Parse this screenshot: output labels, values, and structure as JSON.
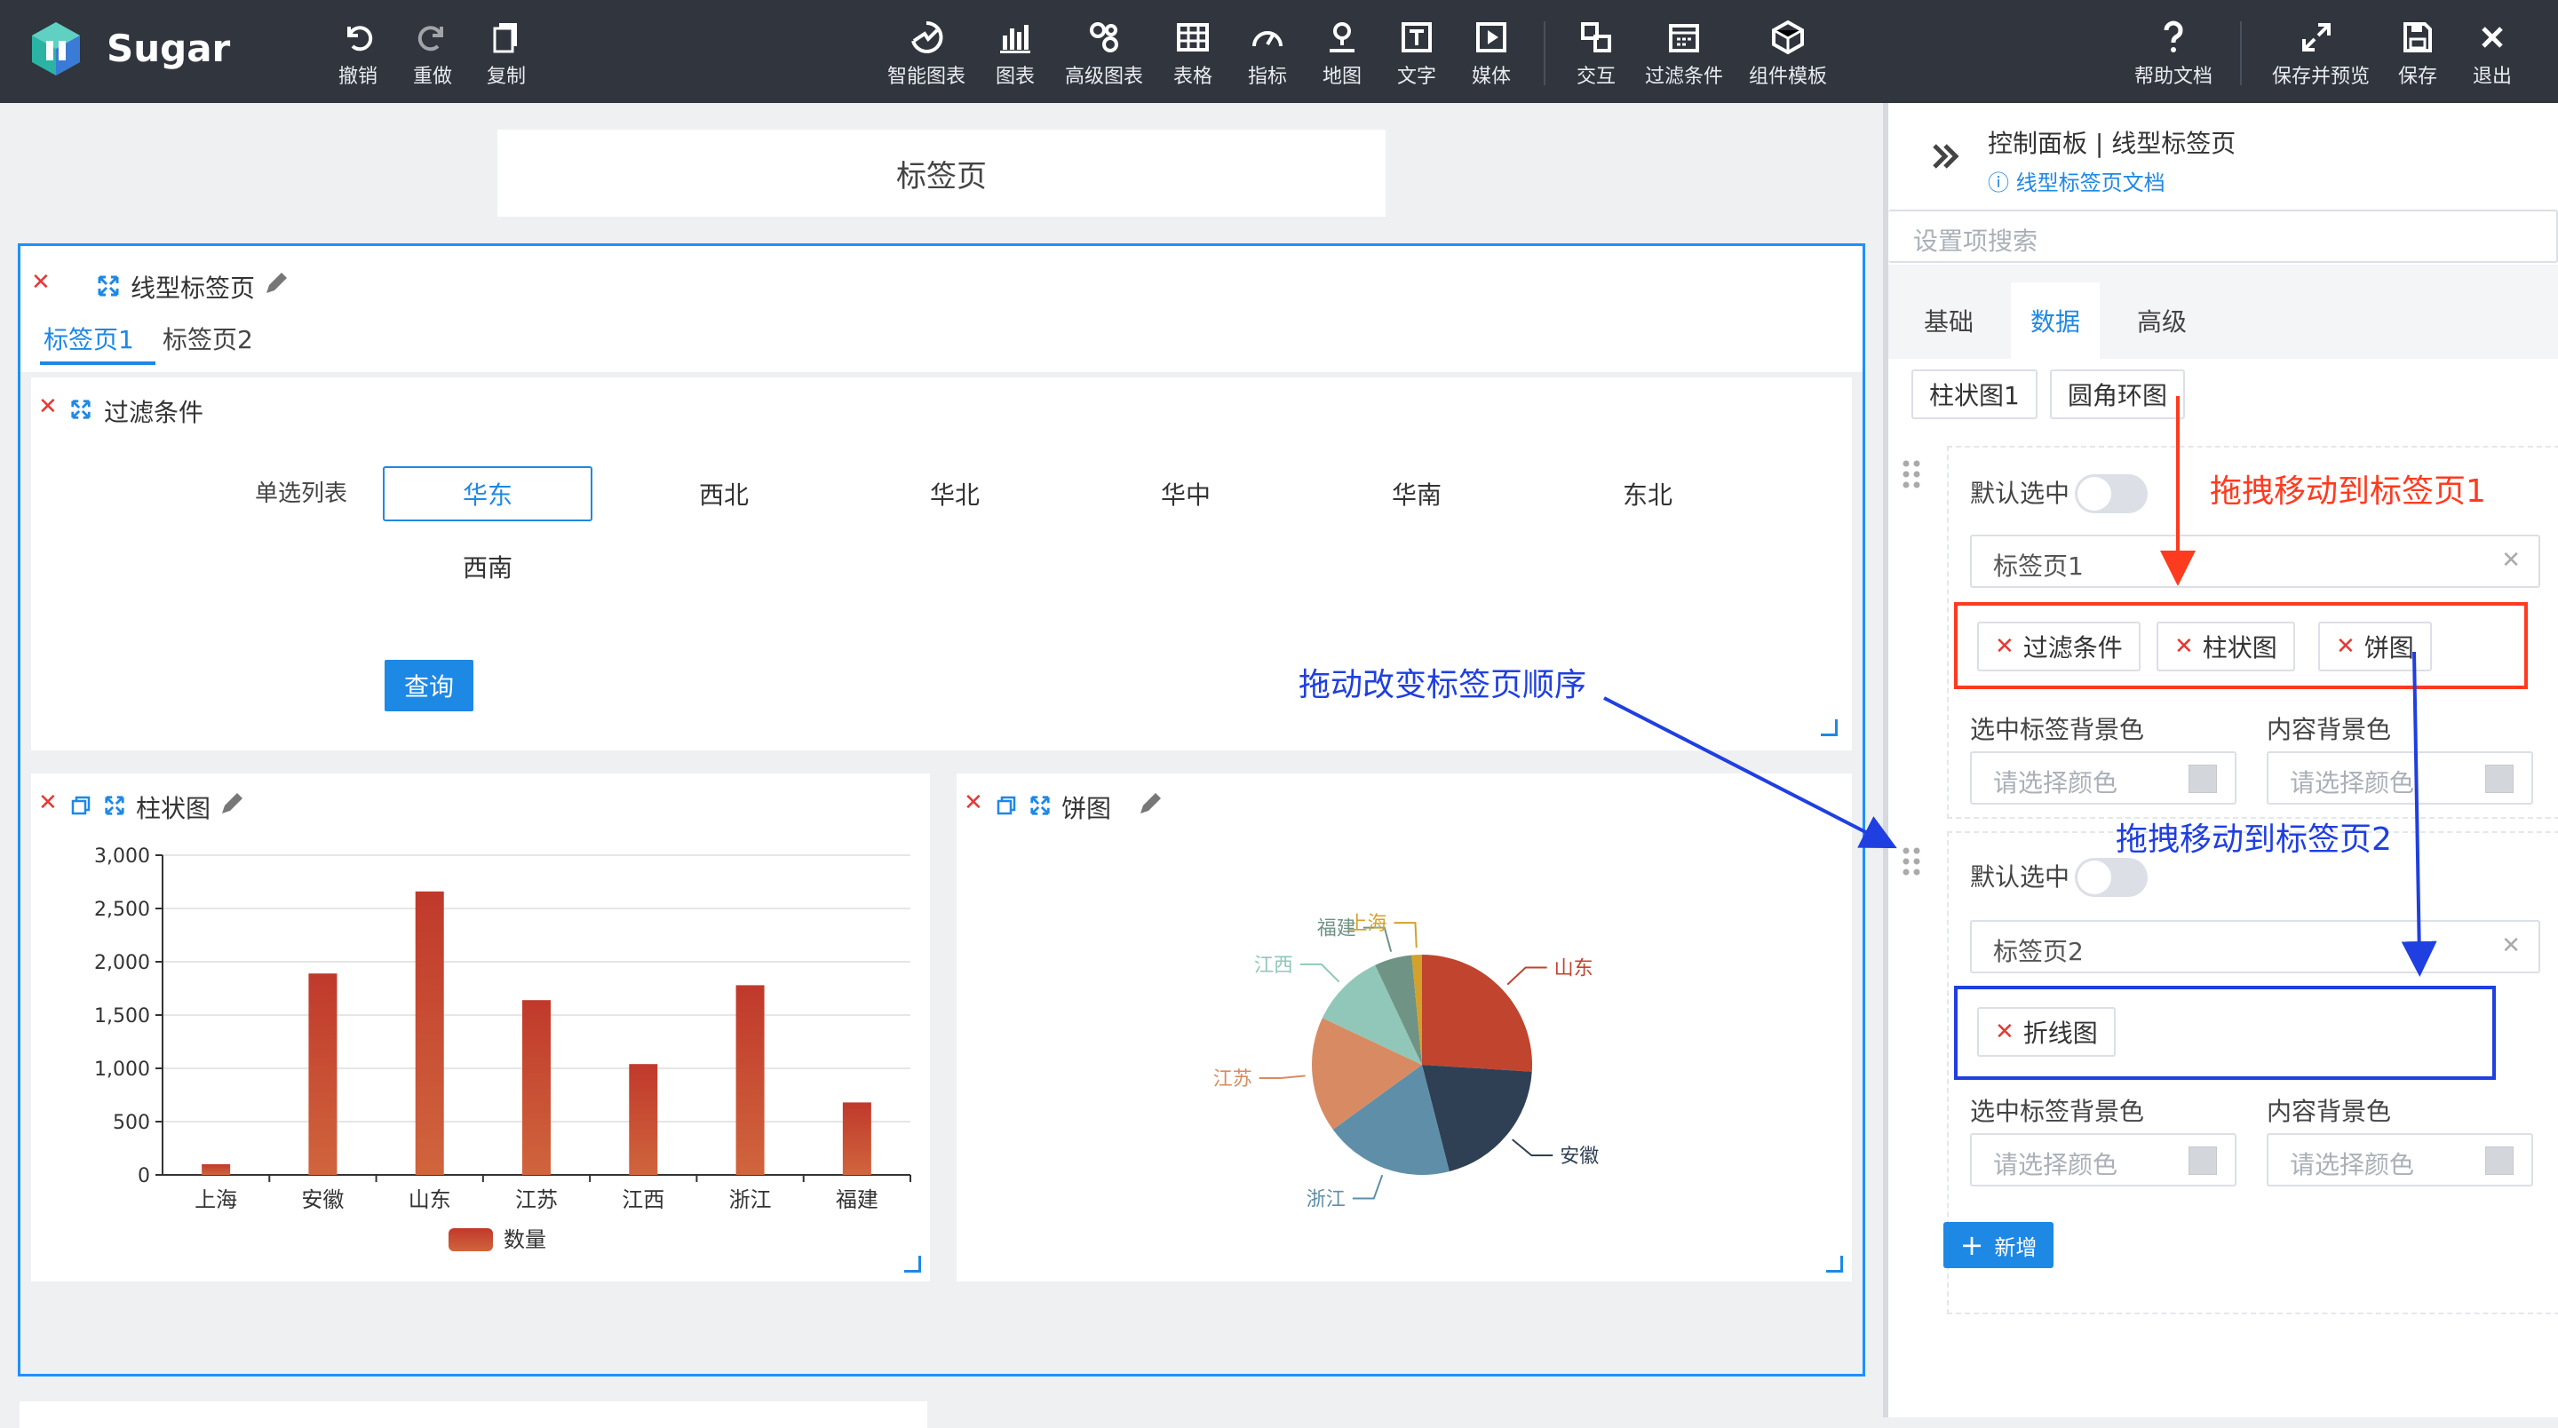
{
  "app": {
    "brand": "Sugar"
  },
  "toolbar": {
    "left": [
      {
        "id": "undo",
        "label": "撤销",
        "icon": "undo-icon"
      },
      {
        "id": "redo",
        "label": "重做",
        "icon": "redo-icon"
      },
      {
        "id": "copy",
        "label": "复制",
        "icon": "copy-icon"
      }
    ],
    "center": [
      {
        "id": "smart-chart",
        "label": "智能图表",
        "icon": "smart-chart-icon"
      },
      {
        "id": "chart",
        "label": "图表",
        "icon": "bar-chart-icon"
      },
      {
        "id": "adv-chart",
        "label": "高级图表",
        "icon": "advanced-chart-icon"
      },
      {
        "id": "table",
        "label": "表格",
        "icon": "table-icon"
      },
      {
        "id": "metric",
        "label": "指标",
        "icon": "gauge-icon"
      },
      {
        "id": "map",
        "label": "地图",
        "icon": "map-pin-icon"
      },
      {
        "id": "text",
        "label": "文字",
        "icon": "text-icon"
      },
      {
        "id": "media",
        "label": "媒体",
        "icon": "media-play-icon"
      },
      {
        "id": "interact",
        "label": "交互",
        "icon": "interaction-icon"
      },
      {
        "id": "filter",
        "label": "过滤条件",
        "icon": "filter-calendar-icon"
      },
      {
        "id": "template",
        "label": "组件模板",
        "icon": "component-template-icon"
      }
    ],
    "right": [
      {
        "id": "help",
        "label": "帮助文档",
        "icon": "help-icon"
      },
      {
        "id": "save-preview",
        "label": "保存并预览",
        "icon": "expand-icon"
      },
      {
        "id": "save",
        "label": "保存",
        "icon": "save-icon"
      },
      {
        "id": "exit",
        "label": "退出",
        "icon": "close-icon"
      }
    ]
  },
  "canvas": {
    "page_title": "标签页",
    "tabs_widget": {
      "title": "线型标签页",
      "tabs": [
        "标签页1",
        "标签页2"
      ],
      "active_tab": 0
    },
    "filter": {
      "title": "过滤条件",
      "label": "单选列表",
      "options": [
        "华东",
        "西北",
        "华北",
        "华中",
        "华南",
        "东北",
        "西南"
      ],
      "selected": "华东",
      "query_label": "查询"
    },
    "bar_widget": {
      "title": "柱状图"
    },
    "pie_widget": {
      "title": "饼图"
    },
    "annotation_reorder": "拖动改变标签页顺序"
  },
  "chart_data": [
    {
      "type": "bar",
      "categories": [
        "上海",
        "安徽",
        "山东",
        "江苏",
        "江西",
        "浙江",
        "福建"
      ],
      "series": [
        {
          "name": "数量",
          "values": [
            100,
            1890,
            2660,
            1640,
            1040,
            1780,
            680
          ]
        }
      ],
      "ylim": [
        0,
        3000
      ],
      "yticks": [
        "0",
        "500",
        "1,000",
        "1,500",
        "2,000",
        "2,500",
        "3,000"
      ],
      "grid": true,
      "legend": "bottom",
      "color": "#c0392b"
    },
    {
      "type": "pie",
      "slices": [
        {
          "label": "山东",
          "value": 26,
          "color": "#c1442e"
        },
        {
          "label": "安徽",
          "value": 20,
          "color": "#2f4054"
        },
        {
          "label": "浙江",
          "value": 19,
          "color": "#5f8ea8"
        },
        {
          "label": "江苏",
          "value": 17,
          "color": "#d88b62"
        },
        {
          "label": "江西",
          "value": 11,
          "color": "#91c7b9"
        },
        {
          "label": "福建",
          "value": 5.5,
          "color": "#6f9385"
        },
        {
          "label": "上海",
          "value": 1.5,
          "color": "#d4a12a"
        }
      ]
    }
  ],
  "panel": {
    "breadcrumb": "控制面板 | 线型标签页",
    "doc_link": "线型标签页文档",
    "search_placeholder": "设置项搜索",
    "tabs": [
      "基础",
      "数据",
      "高级"
    ],
    "active_tab": 1,
    "source_chips": [
      "柱状图1",
      "圆角环图"
    ],
    "tab_items": [
      {
        "default_label": "默认选中",
        "name": "标签页1",
        "components": [
          "过滤条件",
          "柱状图",
          "饼图"
        ],
        "selected_bg_label": "选中标签背景色",
        "content_bg_label": "内容背景色",
        "color_placeholder": "请选择颜色"
      },
      {
        "default_label": "默认选中",
        "name": "标签页2",
        "components": [
          "折线图"
        ],
        "selected_bg_label": "选中标签背景色",
        "content_bg_label": "内容背景色",
        "color_placeholder": "请选择颜色"
      }
    ],
    "add_label": "新增",
    "annotation_tab1": "拖拽移动到标签页1",
    "annotation_tab2": "拖拽移动到标签页2"
  },
  "colors": {
    "topbar": "#30353e",
    "accent": "#1e88e5",
    "danger": "#e53935",
    "annot_red": "#ff3b1f",
    "annot_blue": "#1f3fe0"
  }
}
